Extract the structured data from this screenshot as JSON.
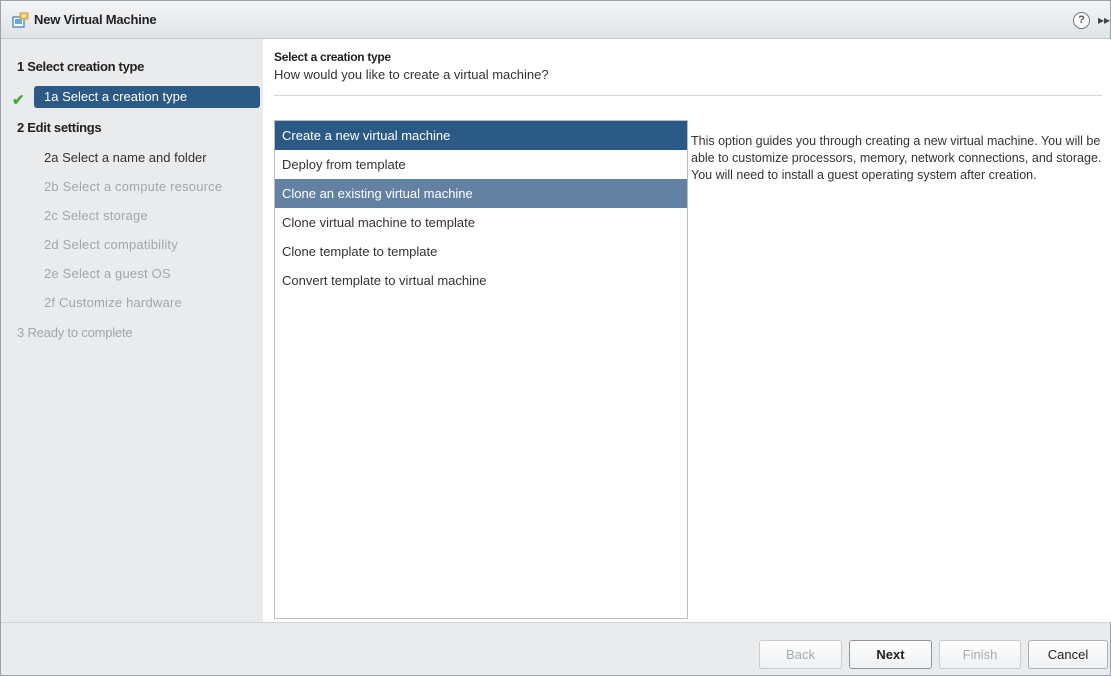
{
  "window": {
    "title": "New Virtual Machine",
    "help_label": "?",
    "collapse_label": "▸▸"
  },
  "sidebar": {
    "items": [
      {
        "label": "1  Select creation type"
      },
      {
        "label": "1a  Select a creation type"
      },
      {
        "label": "2  Edit settings"
      },
      {
        "label": "2a  Select a name and folder"
      },
      {
        "label": "2b  Select a compute resource"
      },
      {
        "label": "2c  Select storage"
      },
      {
        "label": "2d  Select compatibility"
      },
      {
        "label": "2e  Select a guest OS"
      },
      {
        "label": "2f  Customize hardware"
      },
      {
        "label": "3  Ready to complete"
      }
    ],
    "check_glyph": "✔"
  },
  "main": {
    "heading": "Select a creation type",
    "subheading": "How would you like to create a virtual machine?",
    "options": [
      {
        "label": "Create a new virtual machine"
      },
      {
        "label": "Deploy from template"
      },
      {
        "label": "Clone an existing virtual machine"
      },
      {
        "label": "Clone virtual machine to template"
      },
      {
        "label": "Clone template to template"
      },
      {
        "label": "Convert template to virtual machine"
      }
    ],
    "description": "This option guides you through creating a new virtual machine. You will be able to customize processors, memory, network connections, and storage. You will need to install a guest operating system after creation."
  },
  "footer": {
    "back_label": "Back",
    "next_label": "Next",
    "finish_label": "Finish",
    "cancel_label": "Cancel"
  },
  "colors": {
    "selected": "#2c5a87",
    "hover": "#6381a3",
    "sidebar_bg": "#e9ebed",
    "check": "#4aa63a"
  }
}
